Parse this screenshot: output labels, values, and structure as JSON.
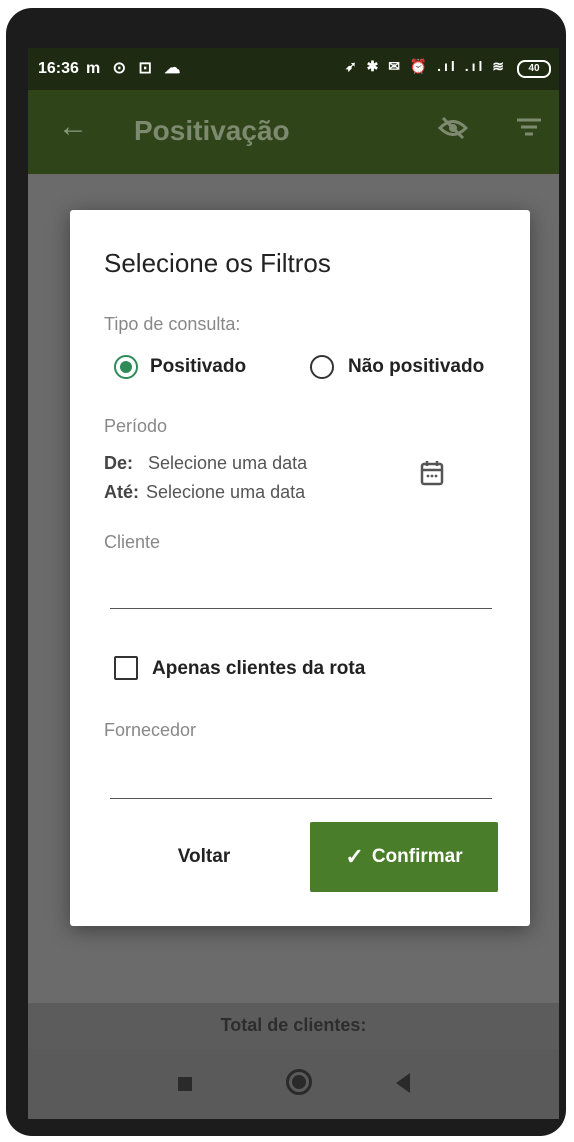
{
  "status": {
    "time": "16:36",
    "left_icons": "m ⊙ ⊡ ☁",
    "right_icons": "➶ ✱ ✉ ⏰ .ıl .ıl ≋",
    "battery": "40"
  },
  "appbar": {
    "back_icon": "arrow-left-icon",
    "title": "Positivação",
    "visibility_icon": "eye-off-icon",
    "filter_icon": "filter-icon"
  },
  "dialog": {
    "title": "Selecione os Filtros",
    "query_type_label": "Tipo de consulta:",
    "options": [
      "Positivado",
      "Não positivado"
    ],
    "selected_option": "Positivado",
    "period_label": "Período",
    "from_key": "De:",
    "from_value": "Selecione uma data",
    "to_key": "Até:",
    "to_value": "Selecione uma data",
    "calendar_icon": "calendar-icon",
    "client_label": "Cliente",
    "client_value": "",
    "route_checkbox_label": "Apenas clientes da rota",
    "route_checkbox_checked": false,
    "supplier_label": "Fornecedor",
    "supplier_value": "",
    "back_button": "Voltar",
    "confirm_button": "Confirmar",
    "accent_color": "#4a7d2a"
  },
  "footer": {
    "total_label": "Total de clientes:"
  }
}
